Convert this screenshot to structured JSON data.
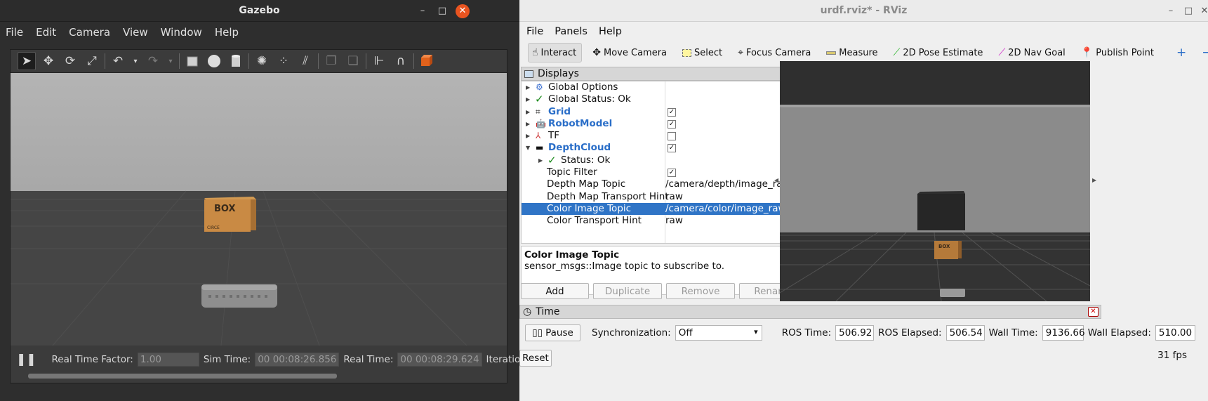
{
  "gazebo": {
    "title": "Gazebo",
    "menu": [
      "File",
      "Edit",
      "Camera",
      "View",
      "Window",
      "Help"
    ],
    "toolbar_icons": [
      "select-arrow-icon",
      "translate-icon",
      "rotate-icon",
      "scale-icon",
      "undo-icon",
      "undo-dropdown-icon",
      "redo-icon",
      "redo-dropdown-icon",
      "box-shape-icon",
      "sphere-shape-icon",
      "cylinder-shape-icon",
      "point-light-icon",
      "spot-light-icon",
      "directional-light-icon",
      "copy-icon",
      "paste-icon",
      "align-icon",
      "snap-icon",
      "view-angle-icon"
    ],
    "bottom": {
      "rtf_label": "Real Time Factor:",
      "rtf_value": "1.00",
      "sim_time_label": "Sim Time:",
      "sim_time_value": "00 00:08:26.856",
      "real_time_label": "Real Time:",
      "real_time_value": "00 00:08:29.624",
      "iterations_label": "Iteration"
    },
    "box_label": "BOX",
    "box_sublabel": "CIRCE"
  },
  "rviz": {
    "title": "urdf.rviz* - RViz",
    "menu": [
      "File",
      "Panels",
      "Help"
    ],
    "tools": [
      {
        "label": "Interact",
        "icon": "hand-icon",
        "active": true
      },
      {
        "label": "Move Camera",
        "icon": "move-camera-icon"
      },
      {
        "label": "Select",
        "icon": "select-box-icon"
      },
      {
        "label": "Focus Camera",
        "icon": "focus-camera-icon"
      },
      {
        "label": "Measure",
        "icon": "measure-icon"
      },
      {
        "label": "2D Pose Estimate",
        "icon": "pose-estimate-icon"
      },
      {
        "label": "2D Nav Goal",
        "icon": "nav-goal-icon"
      },
      {
        "label": "Publish Point",
        "icon": "publish-point-icon"
      }
    ],
    "displays": {
      "title": "Displays",
      "rows": [
        {
          "label": "Global Options"
        },
        {
          "label": "Global Status: Ok"
        },
        {
          "label": "Grid"
        },
        {
          "label": "RobotModel"
        },
        {
          "label": "TF"
        },
        {
          "label": "DepthCloud"
        },
        {
          "label": "Status: Ok"
        },
        {
          "label": "Topic Filter"
        },
        {
          "label": "Depth Map Topic",
          "value": "/camera/depth/image_raw"
        },
        {
          "label": "Depth Map Transport Hint",
          "value": "raw"
        },
        {
          "label": "Color Image Topic",
          "value": "/camera/color/image_raw"
        },
        {
          "label": "Color Transport Hint",
          "value": "raw"
        }
      ],
      "description_title": "Color Image Topic",
      "description_text": "sensor_msgs::Image topic to subscribe to.",
      "buttons": [
        "Add",
        "Duplicate",
        "Remove",
        "Rename"
      ]
    },
    "time": {
      "title": "Time",
      "pause": "Pause",
      "sync_label": "Synchronization:",
      "sync_value": "Off",
      "ros_time_label": "ROS Time:",
      "ros_time_value": "506.92",
      "ros_elapsed_label": "ROS Elapsed:",
      "ros_elapsed_value": "506.54",
      "wall_time_label": "Wall Time:",
      "wall_time_value": "9136.66",
      "wall_elapsed_label": "Wall Elapsed:",
      "wall_elapsed_value": "510.00",
      "reset": "Reset",
      "fps": "31 fps"
    },
    "box_label": "BOX"
  }
}
